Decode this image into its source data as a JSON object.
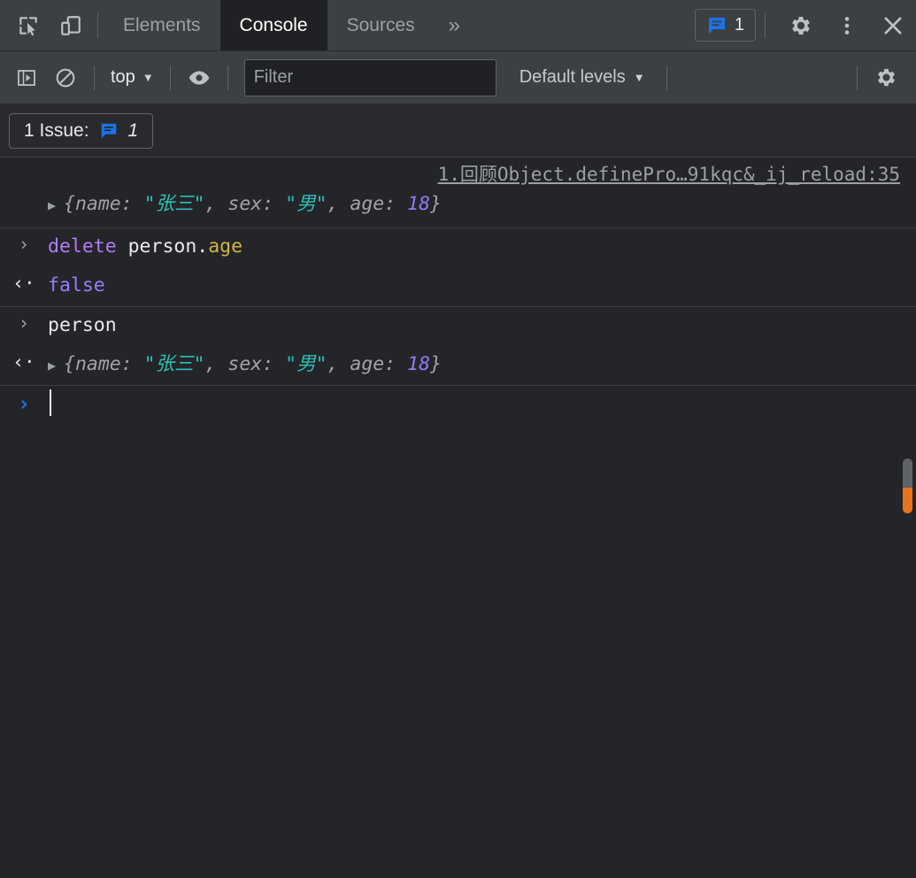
{
  "window": {
    "app": "Chrome DevTools",
    "theme_bg": "#202124",
    "accent": "#1a73e8"
  },
  "tabbar": {
    "inspect_icon": "inspect-cursor-icon",
    "device_icon": "device-toolbar-icon",
    "tabs": [
      {
        "label": "Elements",
        "selected": false
      },
      {
        "label": "Console",
        "selected": true
      },
      {
        "label": "Sources",
        "selected": false
      }
    ],
    "more_tabs_label": "»",
    "issues_chip": {
      "icon": "issue-message-icon",
      "count": "1",
      "color": "#1a73e8"
    },
    "settings_icon": "gear-icon",
    "more_options_icon": "vertical-dots-icon",
    "close_icon": "close-icon"
  },
  "console_toolbar": {
    "sidebar_toggle_icon": "console-sidebar-icon",
    "clear_icon": "clear-console-icon",
    "context_selector": {
      "label": "top",
      "caret": "▼"
    },
    "eye_icon": "live-expression-eye-icon",
    "filter": {
      "value": "",
      "placeholder": "Filter"
    },
    "levels": {
      "label": "Default levels",
      "caret": "▼"
    },
    "settings_icon": "console-settings-gear-icon"
  },
  "issues_bar": {
    "label": "1 Issue:",
    "icon": "issue-message-icon",
    "count": "1"
  },
  "console": {
    "rows": [
      {
        "kind": "log",
        "source_link": "1.回顾Object.definePro…91kqc&_ij_reload:35",
        "gutter": "",
        "expand_arrow": "▶",
        "segments": [
          {
            "text": "{name: ",
            "cls": "obj"
          },
          {
            "text": "\"张三\"",
            "cls": "str"
          },
          {
            "text": ", sex: ",
            "cls": "obj"
          },
          {
            "text": "\"男\"",
            "cls": "str"
          },
          {
            "text": ", age: ",
            "cls": "obj"
          },
          {
            "text": "18",
            "cls": "num"
          },
          {
            "text": "}",
            "cls": "obj"
          }
        ]
      },
      {
        "kind": "input",
        "gutter": "›",
        "segments": [
          {
            "text": "delete ",
            "cls": "kw"
          },
          {
            "text": "person.",
            "cls": "plain"
          },
          {
            "text": "age",
            "cls": "prop"
          }
        ]
      },
      {
        "kind": "output",
        "gutter": "‹·",
        "segments": [
          {
            "text": "false",
            "cls": "bool"
          }
        ]
      },
      {
        "kind": "input",
        "gutter": "›",
        "segments": [
          {
            "text": "person",
            "cls": "plain"
          }
        ]
      },
      {
        "kind": "output",
        "gutter": "‹·",
        "expand_arrow": "▶",
        "segments": [
          {
            "text": "{name: ",
            "cls": "obj"
          },
          {
            "text": "\"张三\"",
            "cls": "str"
          },
          {
            "text": ", sex: ",
            "cls": "obj"
          },
          {
            "text": "\"男\"",
            "cls": "str"
          },
          {
            "text": ", age: ",
            "cls": "obj"
          },
          {
            "text": "18",
            "cls": "num"
          },
          {
            "text": "}",
            "cls": "obj"
          }
        ]
      }
    ],
    "prompt": {
      "gutter": "›",
      "value": ""
    }
  },
  "scrollbar": {
    "present": true,
    "highlight_color": "#e8731c"
  }
}
